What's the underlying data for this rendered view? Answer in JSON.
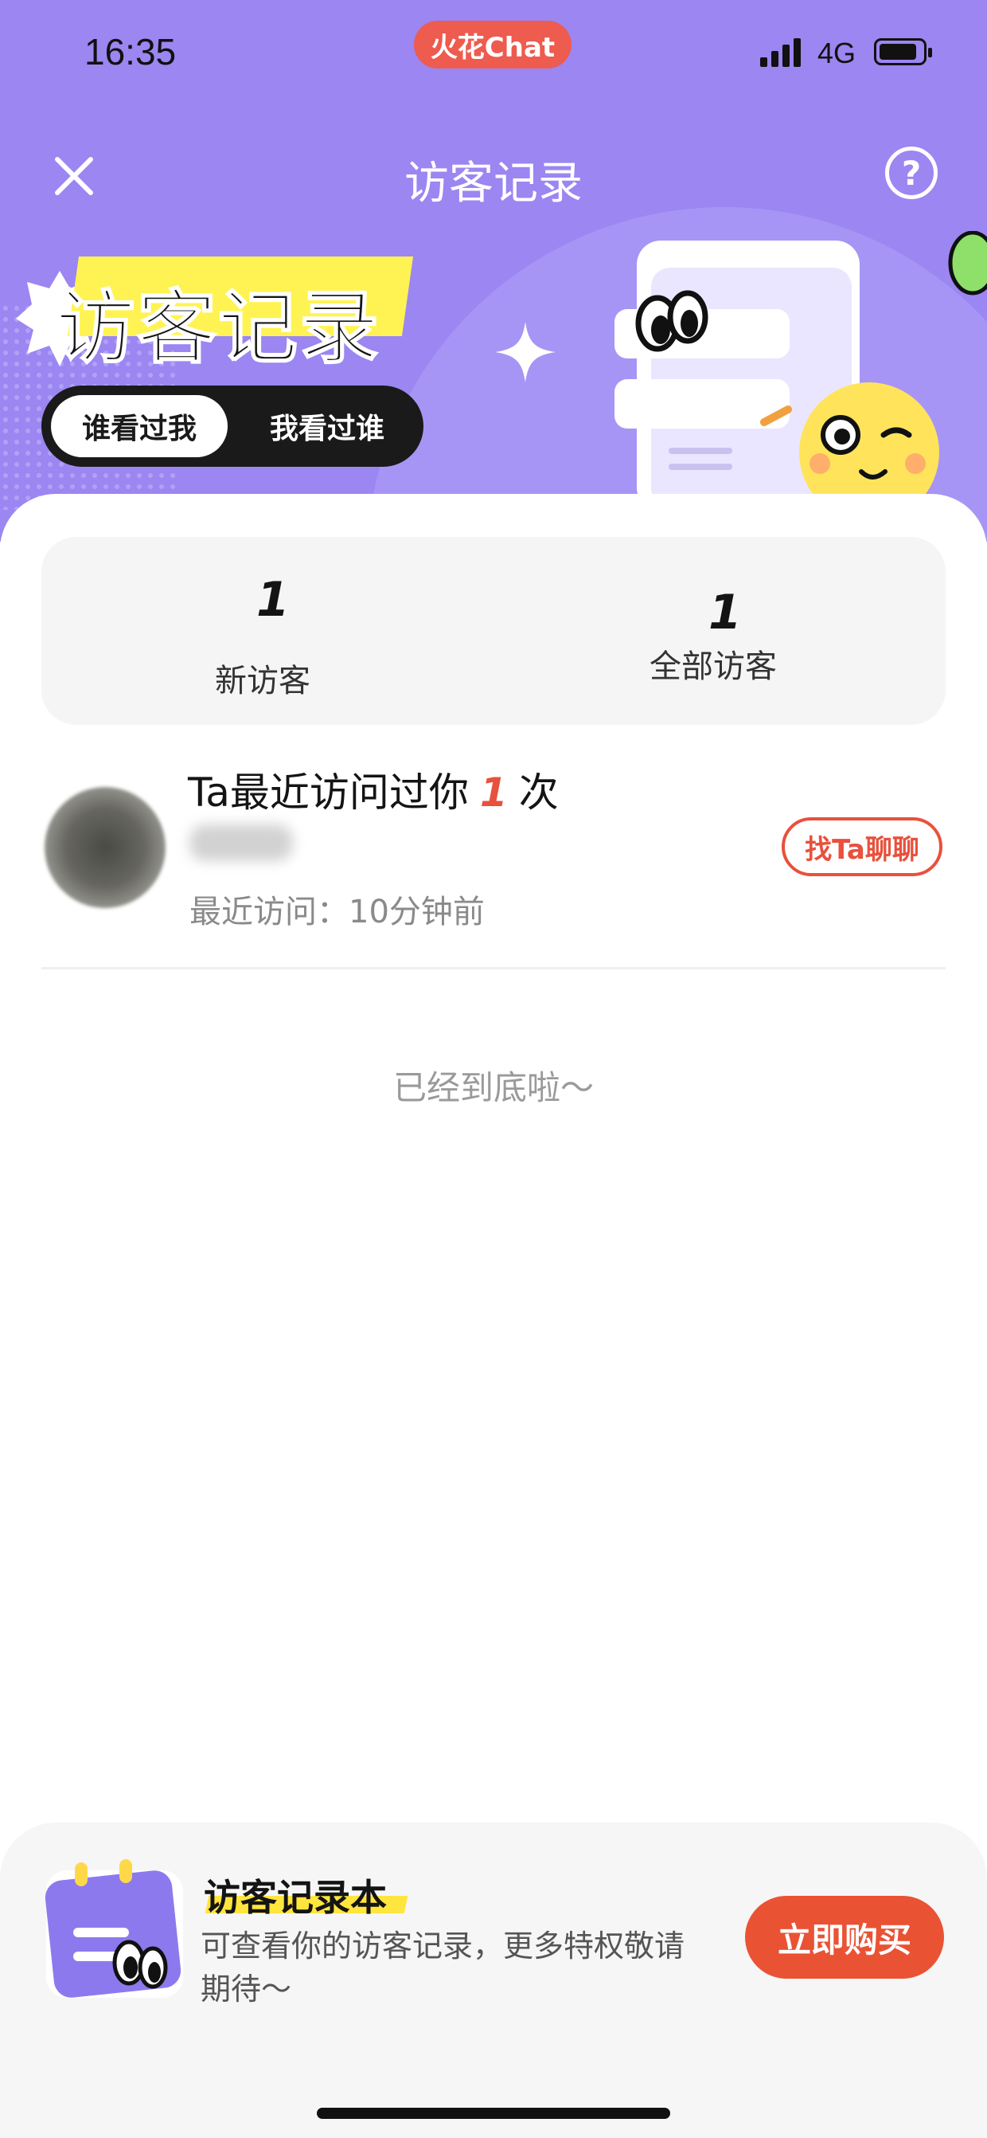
{
  "status_bar": {
    "time": "16:35",
    "app_pill": "火花Chat",
    "network": "4G"
  },
  "header": {
    "title": "访客记录",
    "help_symbol": "?",
    "close_icon": "close-icon"
  },
  "banner": {
    "title": "访客记录"
  },
  "tabs": [
    {
      "label": "谁看过我",
      "active": true
    },
    {
      "label": "我看过谁",
      "active": false
    }
  ],
  "stats": {
    "new_visitors": {
      "value": "1",
      "label": "新访客"
    },
    "all_visitors": {
      "value": "1",
      "label": "全部访客"
    }
  },
  "visitors": [
    {
      "title_prefix": "Ta最近访问过你",
      "count": "1",
      "title_suffix": "次",
      "last_visit": "最近访问：10分钟前",
      "action_label": "找Ta聊聊"
    }
  ],
  "list_end_text": "已经到底啦～",
  "promo": {
    "title": "访客记录本",
    "description": "可查看你的访客记录，更多特权敬请期待～",
    "button_label": "立即购买"
  },
  "colors": {
    "header_bg": "#9b86f2",
    "accent_red": "#e8513d",
    "highlight_yellow": "#fff353"
  }
}
